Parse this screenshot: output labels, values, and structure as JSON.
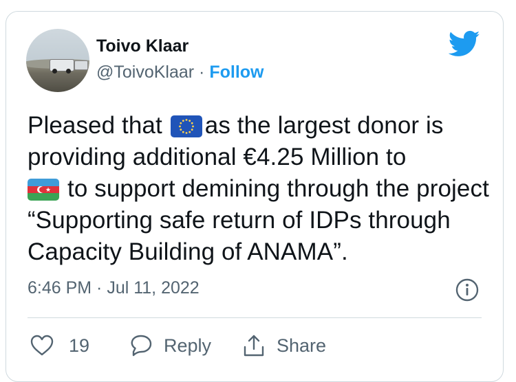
{
  "author": {
    "name": "Toivo Klaar",
    "handle": "@ToivoKlaar",
    "separator": " · ",
    "follow_label": "Follow"
  },
  "tweet": {
    "text_1": "Pleased that",
    "text_2": "as the largest donor is providing additional €4.25 Million to",
    "text_3": "to support demining through the project “Supporting safe return of IDPs through Capacity Building of ANAMA”.",
    "emojis": [
      "eu-flag-emoji",
      "azerbaijan-flag-emoji"
    ]
  },
  "timestamp": "6:46 PM · Jul 11, 2022",
  "actions": {
    "like_count": "19",
    "reply_label": "Reply",
    "share_label": "Share"
  },
  "colors": {
    "accent": "#1d9bf0",
    "secondary_text": "#536471",
    "border": "#cfd9de",
    "text": "#0f1419"
  }
}
